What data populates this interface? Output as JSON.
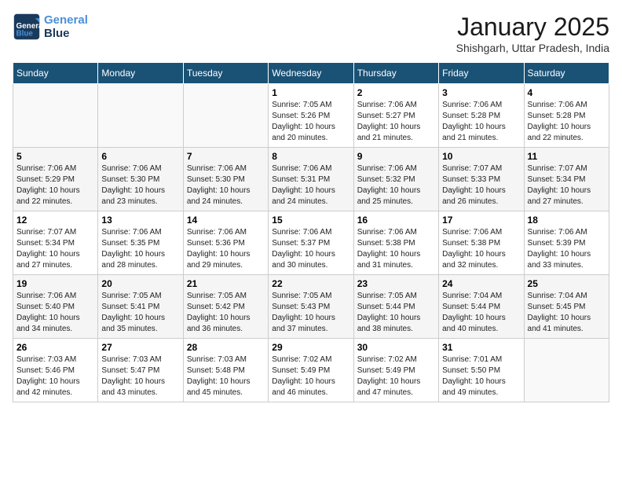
{
  "header": {
    "logo_line1": "General",
    "logo_line2": "Blue",
    "month_title": "January 2025",
    "location": "Shishgarh, Uttar Pradesh, India"
  },
  "weekdays": [
    "Sunday",
    "Monday",
    "Tuesday",
    "Wednesday",
    "Thursday",
    "Friday",
    "Saturday"
  ],
  "weeks": [
    [
      {
        "day": "",
        "empty": true
      },
      {
        "day": "",
        "empty": true
      },
      {
        "day": "",
        "empty": true
      },
      {
        "day": "1",
        "sunrise": "7:05 AM",
        "sunset": "5:26 PM",
        "daylight": "10 hours and 20 minutes."
      },
      {
        "day": "2",
        "sunrise": "7:06 AM",
        "sunset": "5:27 PM",
        "daylight": "10 hours and 21 minutes."
      },
      {
        "day": "3",
        "sunrise": "7:06 AM",
        "sunset": "5:28 PM",
        "daylight": "10 hours and 21 minutes."
      },
      {
        "day": "4",
        "sunrise": "7:06 AM",
        "sunset": "5:28 PM",
        "daylight": "10 hours and 22 minutes."
      }
    ],
    [
      {
        "day": "5",
        "sunrise": "7:06 AM",
        "sunset": "5:29 PM",
        "daylight": "10 hours and 22 minutes."
      },
      {
        "day": "6",
        "sunrise": "7:06 AM",
        "sunset": "5:30 PM",
        "daylight": "10 hours and 23 minutes."
      },
      {
        "day": "7",
        "sunrise": "7:06 AM",
        "sunset": "5:30 PM",
        "daylight": "10 hours and 24 minutes."
      },
      {
        "day": "8",
        "sunrise": "7:06 AM",
        "sunset": "5:31 PM",
        "daylight": "10 hours and 24 minutes."
      },
      {
        "day": "9",
        "sunrise": "7:06 AM",
        "sunset": "5:32 PM",
        "daylight": "10 hours and 25 minutes."
      },
      {
        "day": "10",
        "sunrise": "7:07 AM",
        "sunset": "5:33 PM",
        "daylight": "10 hours and 26 minutes."
      },
      {
        "day": "11",
        "sunrise": "7:07 AM",
        "sunset": "5:34 PM",
        "daylight": "10 hours and 27 minutes."
      }
    ],
    [
      {
        "day": "12",
        "sunrise": "7:07 AM",
        "sunset": "5:34 PM",
        "daylight": "10 hours and 27 minutes."
      },
      {
        "day": "13",
        "sunrise": "7:06 AM",
        "sunset": "5:35 PM",
        "daylight": "10 hours and 28 minutes."
      },
      {
        "day": "14",
        "sunrise": "7:06 AM",
        "sunset": "5:36 PM",
        "daylight": "10 hours and 29 minutes."
      },
      {
        "day": "15",
        "sunrise": "7:06 AM",
        "sunset": "5:37 PM",
        "daylight": "10 hours and 30 minutes."
      },
      {
        "day": "16",
        "sunrise": "7:06 AM",
        "sunset": "5:38 PM",
        "daylight": "10 hours and 31 minutes."
      },
      {
        "day": "17",
        "sunrise": "7:06 AM",
        "sunset": "5:38 PM",
        "daylight": "10 hours and 32 minutes."
      },
      {
        "day": "18",
        "sunrise": "7:06 AM",
        "sunset": "5:39 PM",
        "daylight": "10 hours and 33 minutes."
      }
    ],
    [
      {
        "day": "19",
        "sunrise": "7:06 AM",
        "sunset": "5:40 PM",
        "daylight": "10 hours and 34 minutes."
      },
      {
        "day": "20",
        "sunrise": "7:05 AM",
        "sunset": "5:41 PM",
        "daylight": "10 hours and 35 minutes."
      },
      {
        "day": "21",
        "sunrise": "7:05 AM",
        "sunset": "5:42 PM",
        "daylight": "10 hours and 36 minutes."
      },
      {
        "day": "22",
        "sunrise": "7:05 AM",
        "sunset": "5:43 PM",
        "daylight": "10 hours and 37 minutes."
      },
      {
        "day": "23",
        "sunrise": "7:05 AM",
        "sunset": "5:44 PM",
        "daylight": "10 hours and 38 minutes."
      },
      {
        "day": "24",
        "sunrise": "7:04 AM",
        "sunset": "5:44 PM",
        "daylight": "10 hours and 40 minutes."
      },
      {
        "day": "25",
        "sunrise": "7:04 AM",
        "sunset": "5:45 PM",
        "daylight": "10 hours and 41 minutes."
      }
    ],
    [
      {
        "day": "26",
        "sunrise": "7:03 AM",
        "sunset": "5:46 PM",
        "daylight": "10 hours and 42 minutes."
      },
      {
        "day": "27",
        "sunrise": "7:03 AM",
        "sunset": "5:47 PM",
        "daylight": "10 hours and 43 minutes."
      },
      {
        "day": "28",
        "sunrise": "7:03 AM",
        "sunset": "5:48 PM",
        "daylight": "10 hours and 45 minutes."
      },
      {
        "day": "29",
        "sunrise": "7:02 AM",
        "sunset": "5:49 PM",
        "daylight": "10 hours and 46 minutes."
      },
      {
        "day": "30",
        "sunrise": "7:02 AM",
        "sunset": "5:49 PM",
        "daylight": "10 hours and 47 minutes."
      },
      {
        "day": "31",
        "sunrise": "7:01 AM",
        "sunset": "5:50 PM",
        "daylight": "10 hours and 49 minutes."
      },
      {
        "day": "",
        "empty": true
      }
    ]
  ]
}
